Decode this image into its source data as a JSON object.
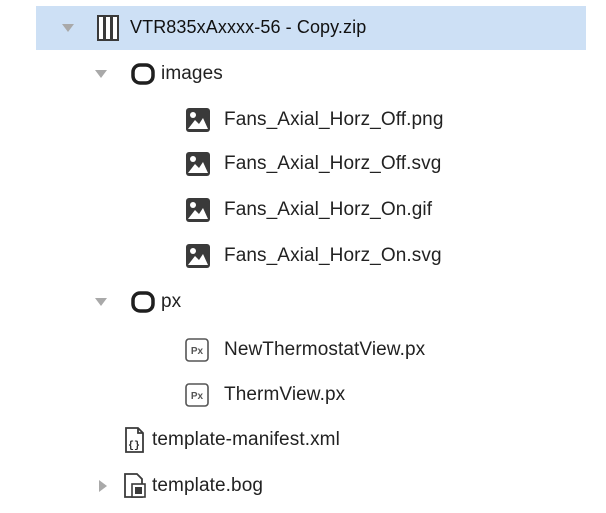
{
  "tree": {
    "root": {
      "label": "VTR835xAxxxx-56 - Copy.zip",
      "icon": "zip-archive-icon",
      "expanded": true,
      "selected": true
    },
    "images_folder": {
      "label": "images",
      "icon": "folder-icon",
      "expanded": true,
      "files": [
        {
          "label": "Fans_Axial_Horz_Off.png",
          "icon": "image-file-icon"
        },
        {
          "label": "Fans_Axial_Horz_Off.svg",
          "icon": "image-file-icon"
        },
        {
          "label": "Fans_Axial_Horz_On.gif",
          "icon": "image-file-icon"
        },
        {
          "label": "Fans_Axial_Horz_On.svg",
          "icon": "image-file-icon"
        }
      ]
    },
    "px_folder": {
      "label": "px",
      "icon": "folder-icon",
      "expanded": true,
      "files": [
        {
          "label": "NewThermostatView.px",
          "icon": "px-file-icon",
          "badge": "Px"
        },
        {
          "label": "ThermView.px",
          "icon": "px-file-icon",
          "badge": "Px"
        }
      ]
    },
    "manifest": {
      "label": "template-manifest.xml",
      "icon": "xml-file-icon"
    },
    "bog": {
      "label": "template.bog",
      "icon": "bog-file-icon",
      "expanded": false
    }
  },
  "colors": {
    "selection": "#cde0f5",
    "arrow": "#a9a9a9",
    "text": "#222222",
    "icon_dark": "#3a3a3a"
  }
}
